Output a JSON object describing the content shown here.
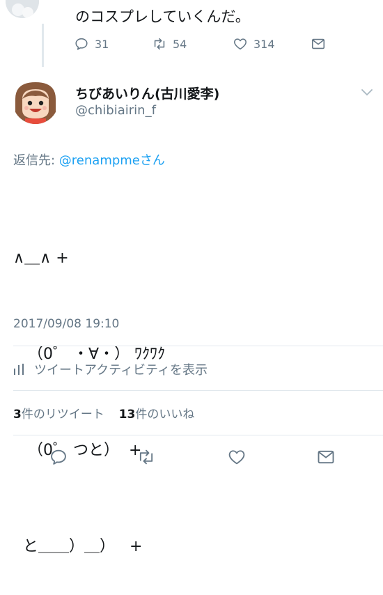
{
  "prev_tweet": {
    "text": "のコスプレしていくんだ。",
    "reply_count": "31",
    "retweet_count": "54",
    "like_count": "314"
  },
  "tweet": {
    "display_name": "ちびあいりん(古川愛李)",
    "handle": "@chibiairin_f",
    "reply_to_label": "返信先: ",
    "reply_to_mention": "@renampme",
    "reply_to_suffix": "さん",
    "body_lines": [
      "∧＿∧ +",
      "   （0゜ ・∀・） ﾜｸﾜｸ",
      "   （0゜ つと）  +",
      "  と＿＿）＿）   +"
    ],
    "timestamp": "2017/09/08 19:10",
    "activity_label": "ツイートアクティビティを表示",
    "retweet_count": "3",
    "retweet_label": "件のリツイート",
    "like_count": "13",
    "like_label": "件のいいね"
  },
  "colors": {
    "text": "#14171a",
    "secondary": "#657786",
    "accent": "#1da1f2",
    "divider": "#e1e8ed"
  },
  "icons": {
    "reply": "reply-icon",
    "retweet": "retweet-icon",
    "like": "heart-icon",
    "dm": "envelope-icon",
    "caret": "chevron-down-icon",
    "activity": "bar-chart-icon"
  }
}
